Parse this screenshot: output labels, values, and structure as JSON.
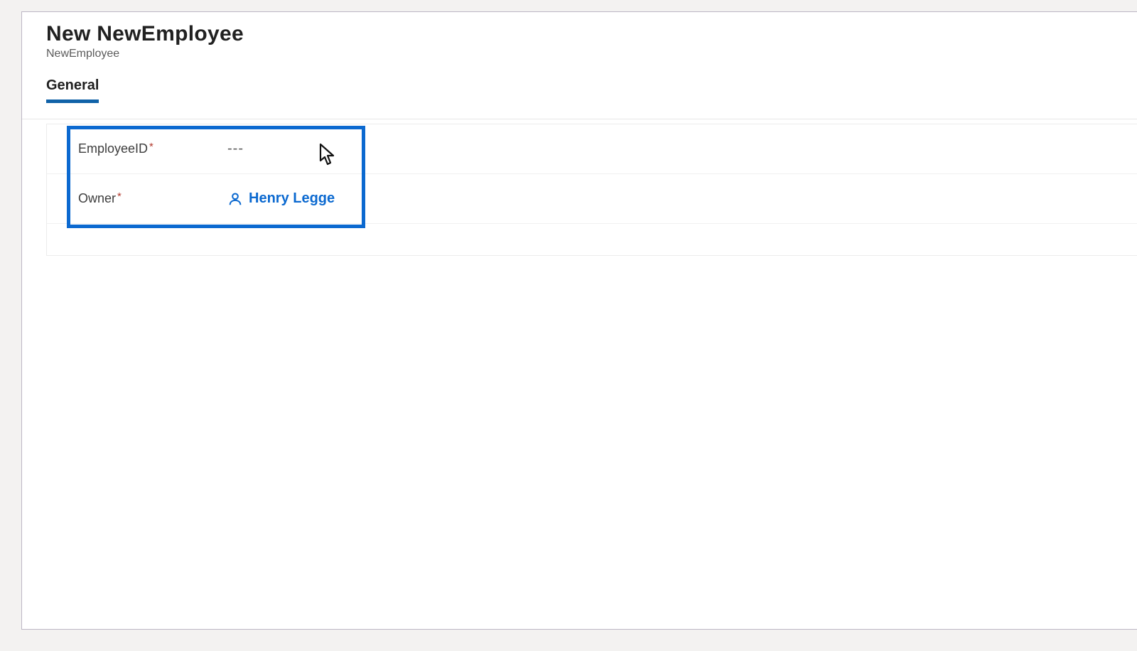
{
  "header": {
    "title": "New NewEmployee",
    "subtitle": "NewEmployee"
  },
  "tabs": {
    "general": "General"
  },
  "form": {
    "employeeId": {
      "label": "EmployeeID",
      "placeholder": "---",
      "required_symbol": "*"
    },
    "owner": {
      "label": "Owner",
      "required_symbol": "*",
      "value": "Henry Legge"
    }
  }
}
